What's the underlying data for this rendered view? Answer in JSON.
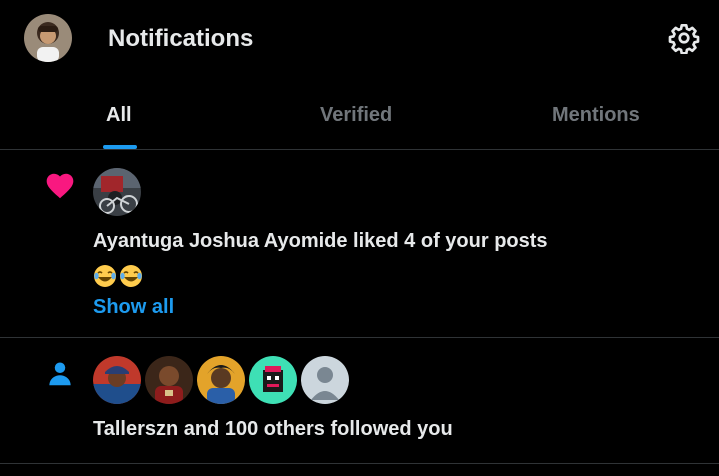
{
  "header": {
    "title": "Notifications",
    "settings_icon": "gear-icon"
  },
  "tabs": [
    {
      "label": "All",
      "active": true
    },
    {
      "label": "Verified",
      "active": false
    },
    {
      "label": "Mentions",
      "active": false
    }
  ],
  "notifications": [
    {
      "type": "like",
      "icon": "heart-icon",
      "icon_color": "#f91880",
      "text": "Ayantuga Joshua Ayomide liked 4 of your posts",
      "emoji": "😂😂",
      "show_all": "Show all"
    },
    {
      "type": "follow",
      "icon": "person-icon",
      "icon_color": "#1d9bf0",
      "text": "Tallerszn and 100 others followed you"
    }
  ],
  "colors": {
    "background": "#000000",
    "accent": "#1d9bf0",
    "text_primary": "#e7e9ea",
    "text_secondary": "#71767b",
    "divider": "#2f3336"
  }
}
